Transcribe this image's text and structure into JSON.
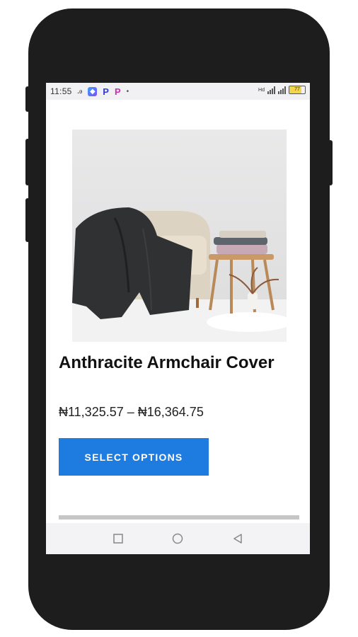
{
  "status_bar": {
    "time": "11:55",
    "battery_level": "77",
    "network_label": "Hd"
  },
  "product": {
    "title": "Anthracite Armchair Cover",
    "price": "₦11,325.57 – ₦16,364.75",
    "select_label": "SELECT OPTIONS"
  },
  "icons": {
    "status": [
      "gesture-icon",
      "app-icon",
      "p-app-icon",
      "p-app-icon",
      "dot-icon"
    ],
    "nav": [
      "recent-apps-icon",
      "home-icon",
      "back-icon"
    ]
  },
  "colors": {
    "button": "#1e7ce0",
    "phone_frame": "#1d1d1d"
  }
}
